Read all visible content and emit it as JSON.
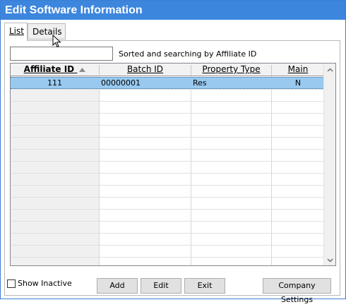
{
  "window": {
    "title": "Edit Software Information"
  },
  "tabs": [
    {
      "label": "List"
    },
    {
      "label": "Details"
    }
  ],
  "search": {
    "value": "",
    "hint": "Sorted and searching by Affiliate ID"
  },
  "grid": {
    "columns": [
      {
        "label": "Affiliate ID",
        "sort": "ascending"
      },
      {
        "label": "Batch ID"
      },
      {
        "label": "Property Type"
      },
      {
        "label": "Main"
      }
    ],
    "rows": [
      {
        "affiliate_id": "111",
        "batch_id": "00000001",
        "property_type": "Res",
        "main": "N",
        "selected": true
      }
    ]
  },
  "show_inactive": {
    "label": "Show Inactive",
    "checked": false
  },
  "buttons": {
    "add": "Add",
    "edit": "Edit",
    "exit": "Exit",
    "company_settings": "Company Settings"
  }
}
